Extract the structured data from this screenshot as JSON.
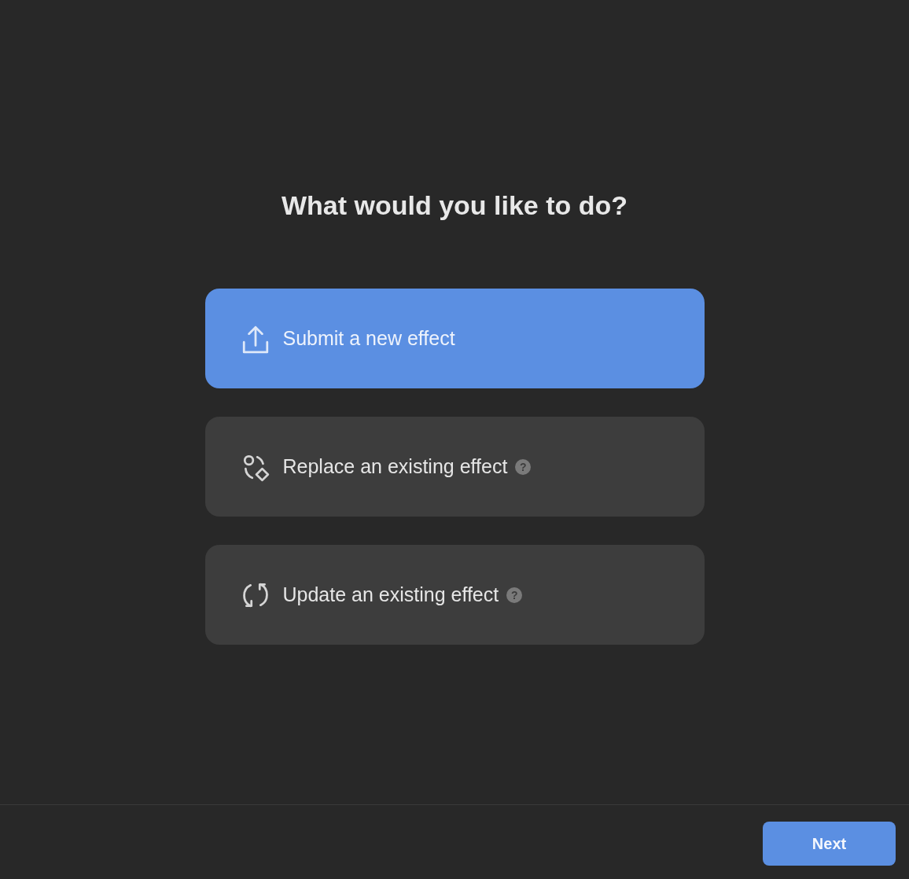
{
  "title": "What would you like to do?",
  "options": [
    {
      "label": "Submit a new effect",
      "kind": "upload",
      "selected": true
    },
    {
      "label": "Replace an existing effect",
      "kind": "replace",
      "selected": false,
      "hint": "?"
    },
    {
      "label": "Update an existing effect",
      "kind": "refresh",
      "selected": false,
      "hint": "?"
    }
  ],
  "footer": {
    "next_button": "Next"
  }
}
